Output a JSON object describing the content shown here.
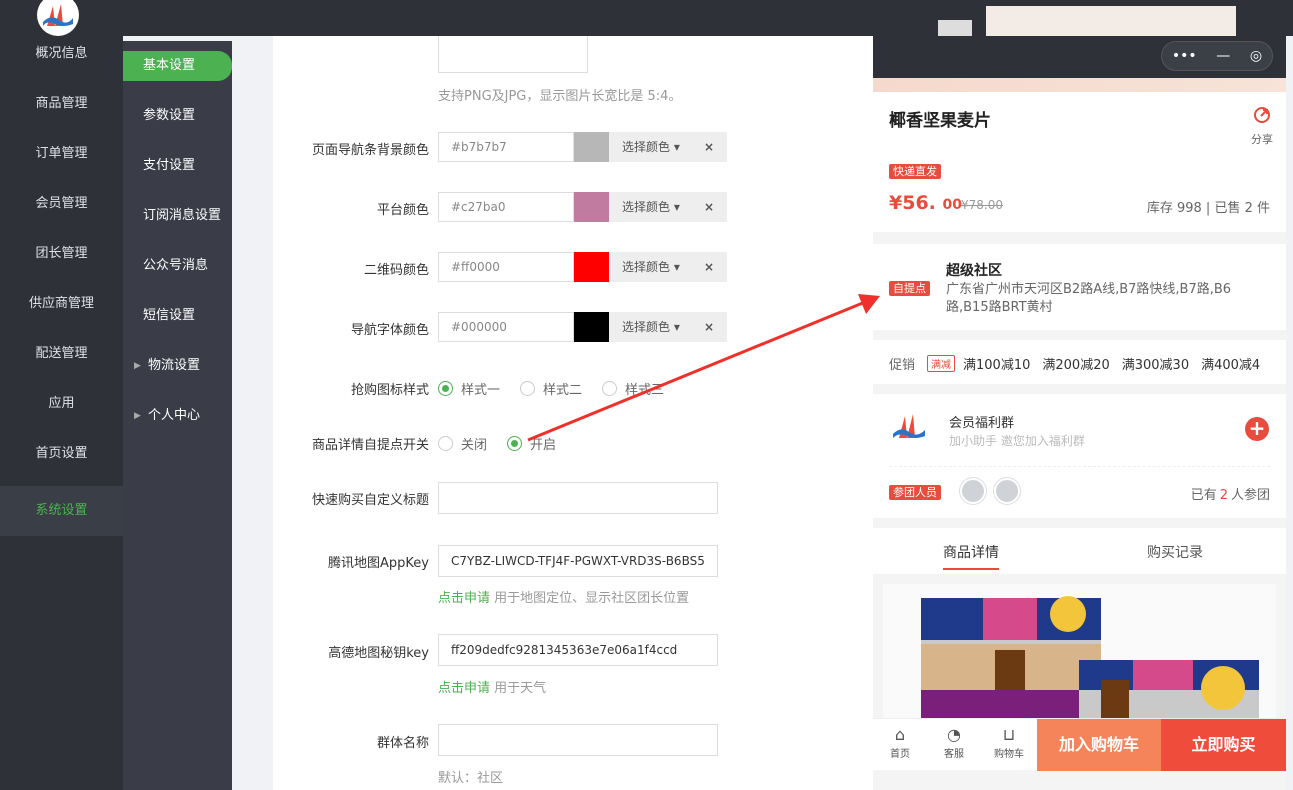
{
  "nav_primary": [
    {
      "label": "概况信息"
    },
    {
      "label": "商品管理"
    },
    {
      "label": "订单管理"
    },
    {
      "label": "会员管理"
    },
    {
      "label": "团长管理"
    },
    {
      "label": "供应商管理"
    },
    {
      "label": "配送管理"
    },
    {
      "label": "应用"
    },
    {
      "label": "首页设置"
    },
    {
      "label": "系统设置"
    }
  ],
  "nav_secondary": [
    {
      "label": "基本设置"
    },
    {
      "label": "参数设置"
    },
    {
      "label": "支付设置"
    },
    {
      "label": "订阅消息设置"
    },
    {
      "label": "公众号消息"
    },
    {
      "label": "短信设置"
    },
    {
      "label": "物流设置"
    },
    {
      "label": "个人中心"
    }
  ],
  "form": {
    "image_hint": "支持PNG及JPG，显示图片长宽比是 5:4。",
    "nav_bg_label": "页面导航条背景颜色",
    "nav_bg_value": "#b7b7b7",
    "nav_bg_swatch": "#b7b7b7",
    "platform_label": "平台颜色",
    "platform_value": "#c27ba0",
    "platform_swatch": "#c27ba0",
    "qrcode_label": "二维码颜色",
    "qrcode_value": "#ff0000",
    "qrcode_swatch": "#ff0000",
    "nav_font_label": "导航字体颜色",
    "nav_font_value": "#000000",
    "nav_font_swatch": "#000000",
    "pick_color": "选择颜色",
    "clear": "×",
    "icon_style_label": "抢购图标样式",
    "style_options": [
      "样式一",
      "样式二",
      "样式三"
    ],
    "style_selected": "样式一",
    "self_pickup_label": "商品详情自提点开关",
    "switch_options": [
      "关闭",
      "开启"
    ],
    "switch_selected": "开启",
    "quick_buy_label": "快速购买自定义标题",
    "quick_buy_value": "",
    "tencent_label": "腾讯地图AppKey",
    "tencent_value": "C7YBZ-LIWCD-TFJ4F-PGWXT-VRD3S-B6BS5",
    "tencent_link": "点击申请",
    "tencent_hint": "用于地图定位、显示社区团长位置",
    "amap_label": "高德地图秘钥key",
    "amap_value": "ff209dedfc9281345363e7e06a1f4ccd",
    "amap_link": "点击申请",
    "amap_hint": "用于天气",
    "group_name_label": "群体名称",
    "group_name_value": "",
    "group_name_hint": "默认：社区"
  },
  "preview": {
    "capsule_more": "•••",
    "capsule_min": "—",
    "capsule_close": "◎",
    "back": "‹",
    "title": "椰香坚果麦片",
    "share": "分享",
    "express_tag": "快递直发",
    "price_int": "¥56.",
    "price_dec": "00",
    "old_price": "¥78.00",
    "stock": "库存 998 | 已售 2 件",
    "pickup_tag": "自提点",
    "community_name": "超级社区",
    "community_addr": "广东省广州市天河区B2路A线,B7路快线,B7路,B6路,B15路BRT黄村",
    "promo_label": "促销",
    "promo_tag": "满减",
    "promo_items": [
      "满100减10",
      "满200减20",
      "满300减30",
      "满400减4"
    ],
    "group_title": "会员福利群",
    "group_sub": "加小助手 邀您加入福利群",
    "plus": "+",
    "members_tag": "参团人员",
    "joined_prefix": "已有",
    "joined_count": "2",
    "joined_suffix": "人参团",
    "tab_detail": "商品详情",
    "tab_records": "购买记录",
    "bottom": [
      {
        "label": "首页",
        "icon": "home-icon"
      },
      {
        "label": "客服",
        "icon": "chat-icon"
      },
      {
        "label": "购物车",
        "icon": "cart-icon"
      }
    ],
    "add_cart": "加入购物车",
    "buy_now": "立即购买"
  },
  "colors": {
    "accent_green": "#4cb151",
    "accent_red": "#e84c3d",
    "sidebar_dark": "#2e3138"
  }
}
